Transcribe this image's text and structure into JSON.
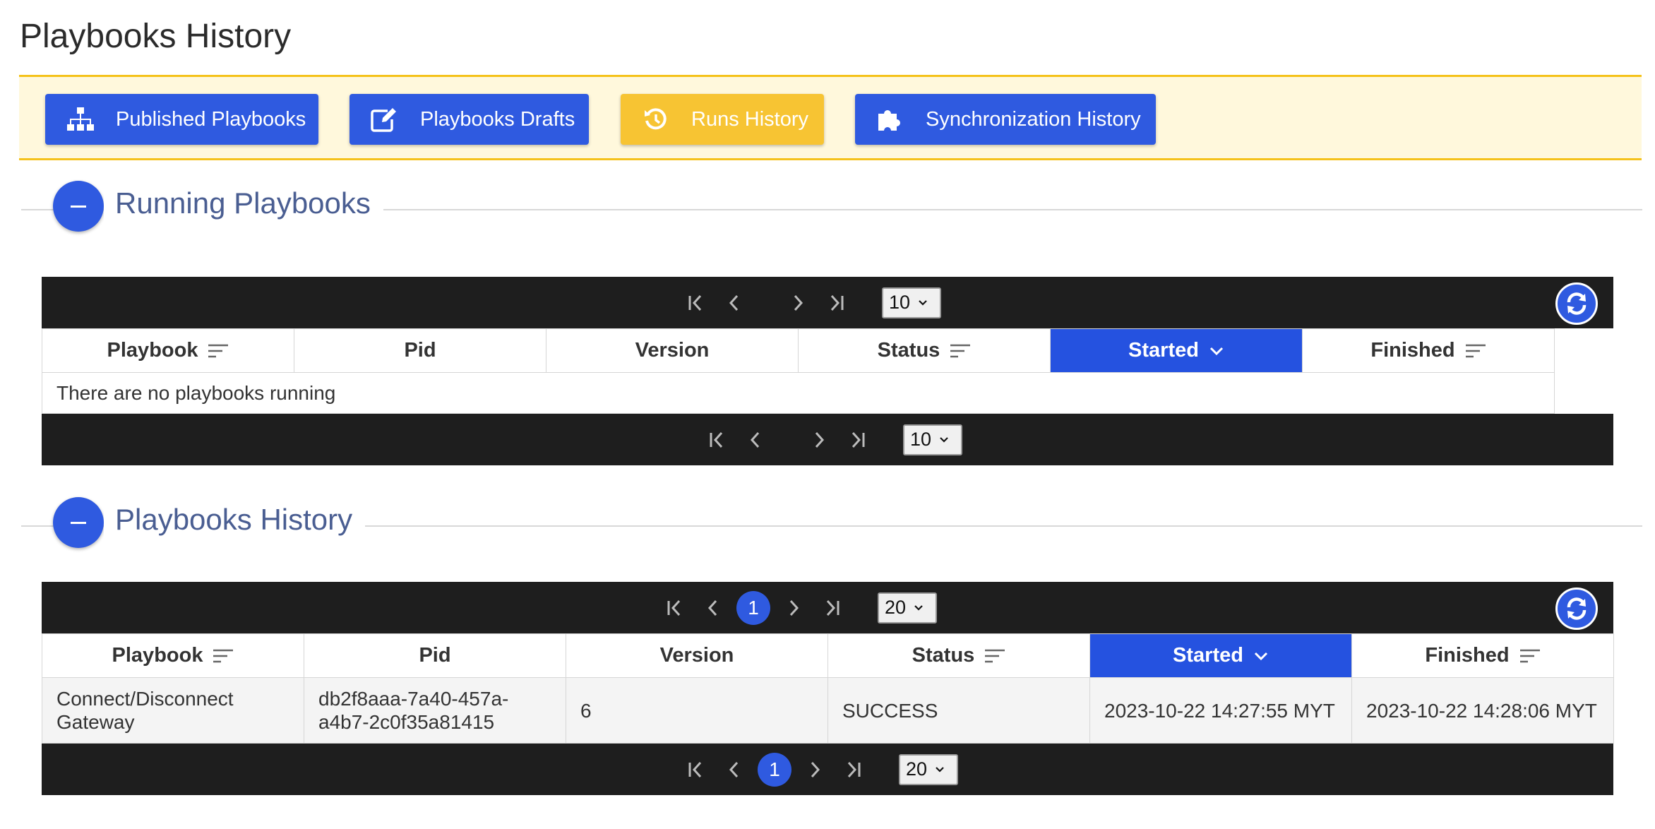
{
  "page_title": "Playbooks History",
  "nav": {
    "buttons": [
      {
        "label": "Published Playbooks",
        "icon": "sitemap-icon",
        "color": "#2f5ae0"
      },
      {
        "label": "Playbooks Drafts",
        "icon": "edit-icon",
        "color": "#2f5ae0"
      },
      {
        "label": "Runs History",
        "icon": "history-icon",
        "color": "#f7c433",
        "active": true
      },
      {
        "label": "Synchronization History",
        "icon": "puzzle-icon",
        "color": "#2f5ae0"
      }
    ]
  },
  "running": {
    "title": "Running Playbooks",
    "page_size": "10",
    "columns": [
      {
        "label": "Playbook",
        "sortable": true
      },
      {
        "label": "Pid",
        "sortable": false
      },
      {
        "label": "Version",
        "sortable": false
      },
      {
        "label": "Status",
        "sortable": true
      },
      {
        "label": "Started",
        "sortable": true,
        "sorted": "desc"
      },
      {
        "label": "Finished",
        "sortable": true
      }
    ],
    "empty_message": "There are no playbooks running"
  },
  "history": {
    "title": "Playbooks History",
    "page_size": "20",
    "current_page": "1",
    "columns": [
      {
        "label": "Playbook",
        "sortable": true
      },
      {
        "label": "Pid",
        "sortable": false
      },
      {
        "label": "Version",
        "sortable": false
      },
      {
        "label": "Status",
        "sortable": true
      },
      {
        "label": "Started",
        "sortable": true,
        "sorted": "desc"
      },
      {
        "label": "Finished",
        "sortable": true
      }
    ],
    "rows": [
      {
        "playbook": [
          "Connect/Disconnect",
          "Gateway"
        ],
        "pid": [
          "db2f8aaa-7a40-457a-",
          "a4b7-2c0f35a81415"
        ],
        "version": "6",
        "status": "SUCCESS",
        "started": "2023-10-22 14:27:55 MYT",
        "finished": "2023-10-22 14:28:06 MYT"
      }
    ]
  },
  "colors": {
    "primary": "#2f5ae0",
    "accent_gold": "#f5c21b",
    "nav_bg": "#fff8dc",
    "pager_bg": "#1e1e1e",
    "section_title": "#4a5e92"
  }
}
